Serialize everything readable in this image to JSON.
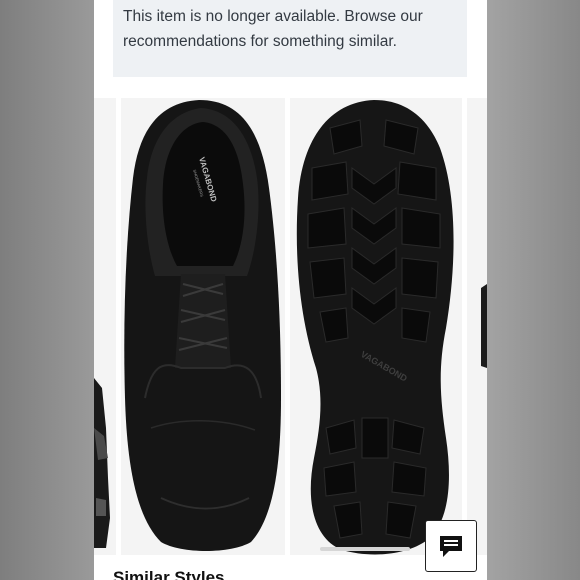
{
  "notice": {
    "line1": "This item is no longer available. Browse our",
    "line2": "recommendations for something similar."
  },
  "product_images": {
    "brand_mark": "VAGABOND",
    "brand_sub": "SHOEMAKERS",
    "sole_mark": "VAGABOND"
  },
  "section": {
    "heading": "Similar Styles"
  },
  "chat": {
    "icon": "chat-bubble-icon"
  },
  "colors": {
    "notice_bg": "#eef1f4",
    "shoe": "#141414",
    "image_bg": "#f4f4f4"
  }
}
